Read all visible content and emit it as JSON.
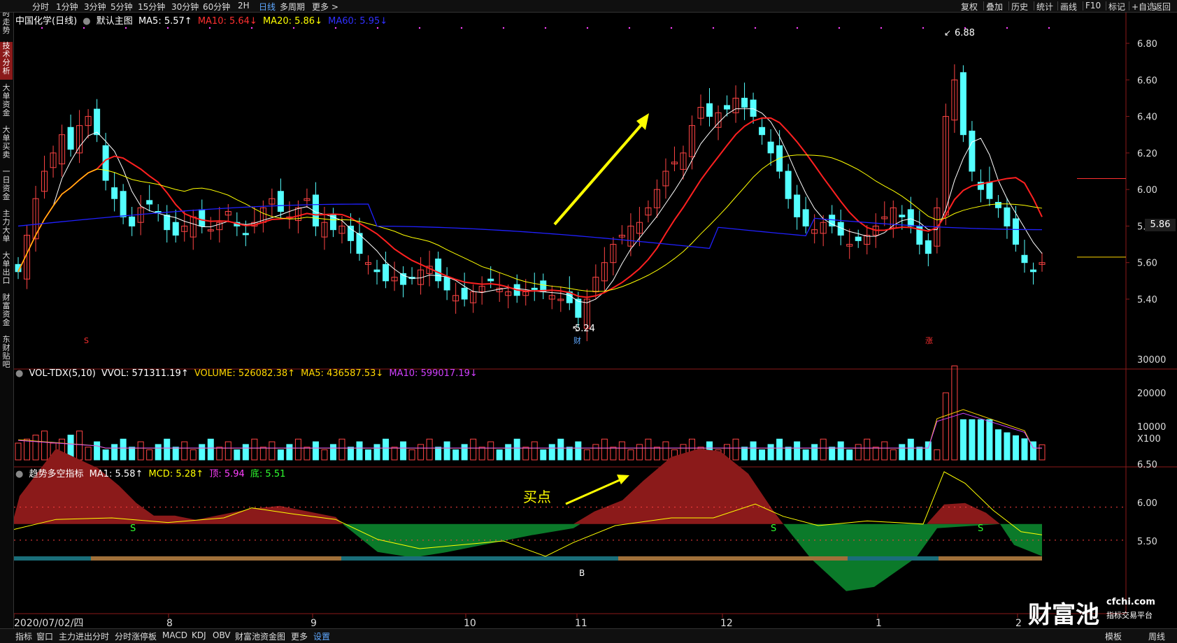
{
  "toolbar": {
    "periods": [
      "分时",
      "1分钟",
      "3分钟",
      "5分钟",
      "15分钟",
      "30分钟",
      "60分钟",
      "2H",
      "日线",
      "多周期",
      "更多 >"
    ],
    "active_period": "日线",
    "right_items": [
      "复权",
      "叠加",
      "历史",
      "统计",
      "画线",
      "F10",
      "标记",
      "+自选",
      "返回"
    ]
  },
  "sidebar": {
    "tabs": [
      "分时走势",
      "技术分析",
      "大单资金",
      "大单买卖",
      "一日资金",
      "主力大单",
      "大单出口",
      "财富资金",
      "东财贴吧"
    ],
    "active": "技术分析"
  },
  "main_panel": {
    "title": "中国化学(日线)",
    "template": "默认主图",
    "ma5": "MA5: 5.57↑",
    "ma10": "MA10: 5.64↓",
    "ma20": "MA20: 5.86↓",
    "ma60": "MA60: 5.95↓",
    "y_ticks": [
      "6.80",
      "6.60",
      "6.40",
      "6.20",
      "6.00",
      "5.80",
      "5.60",
      "5.40"
    ],
    "last_price": "5.86",
    "high_label": "6.88",
    "low_label": "5.24",
    "marker_cai": "财",
    "marker_zhang": "涨",
    "marker_s": "S"
  },
  "vol_panel": {
    "title": "VOL-TDX(5,10)",
    "vvol": "VVOL: 571311.19↑",
    "volume": "VOLUME: 526082.38↑",
    "ma5": "MA5: 436587.53↓",
    "ma10": "MA10: 599017.19↓",
    "y_ticks": [
      "30000",
      "20000",
      "10000"
    ],
    "unit": "X100"
  },
  "ind_panel": {
    "title": "趋势多空指标",
    "ma1": "MA1: 5.58↑",
    "mcd": "MCD: 5.28↑",
    "top": "顶: 5.94",
    "bottom": "底: 5.51",
    "y_ticks": [
      "6.50",
      "6.00",
      "5.50"
    ],
    "buy_label": "买点",
    "s_label": "S",
    "b_label": "B"
  },
  "x_axis": {
    "labels": [
      "2020/07/02/四",
      "8",
      "9",
      "10",
      "11",
      "12",
      "1",
      "2"
    ]
  },
  "bottombar": {
    "items": [
      "指标",
      "窗口",
      "主力进出分时",
      "分时涨停板",
      "MACD",
      "KDJ",
      "OBV",
      "财富池资金图",
      "更多",
      "设置"
    ],
    "active": "设置",
    "right_items": [
      "模板",
      "周线"
    ]
  },
  "watermark": {
    "brand": "财富池",
    "site": "cfchi.com",
    "tagline": "指标交易平台"
  },
  "colors": {
    "up": "#ff4444",
    "down": "#54ffff",
    "ma5": "#ffffff",
    "ma10": "#ff2020",
    "ma20": "#ffff00",
    "ma60": "#2020ff",
    "bull_area": "#8b1a1a",
    "bear_area": "#0b7a2a"
  }
}
